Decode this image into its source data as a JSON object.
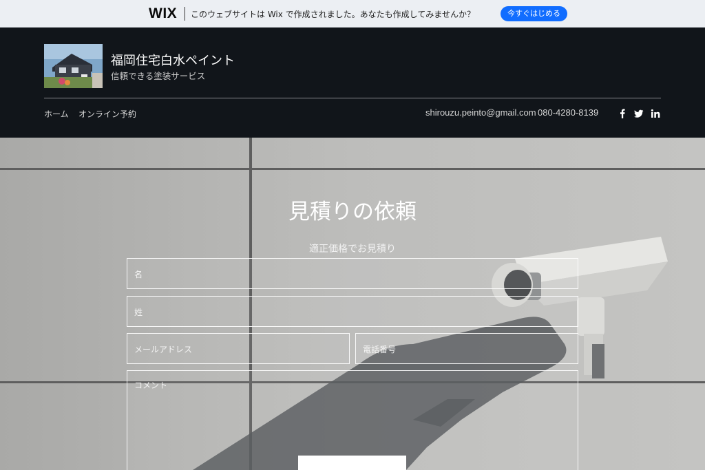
{
  "wix_banner": {
    "logo": "WIX",
    "message": "このウェブサイトは Wix で作成されました。あなたも作成してみませんか？",
    "cta_label": "今すぐはじめる"
  },
  "header": {
    "site_title": "福岡住宅白水ペイント",
    "tagline": "信頼できる塗装サービス",
    "nav": [
      {
        "label": "ホーム"
      },
      {
        "label": "オンライン予約"
      }
    ],
    "email": "shirouzu.peinto@gmail.com",
    "phone": "080-4280-8139",
    "social_icons": [
      "facebook-icon",
      "twitter-icon",
      "linkedin-icon"
    ]
  },
  "hero": {
    "title": "見積りの依頼",
    "subtitle": "適正価格でお見積り",
    "form": {
      "first_name_placeholder": "名",
      "last_name_placeholder": "姓",
      "email_placeholder": "メールアドレス",
      "phone_placeholder": "電話番号",
      "comment_placeholder": "コメント"
    }
  },
  "colors": {
    "wix_banner_bg": "#eceff3",
    "wix_cta": "#116dff",
    "header_bg": "#11151a",
    "hero_wall": "#b9b9b7"
  }
}
